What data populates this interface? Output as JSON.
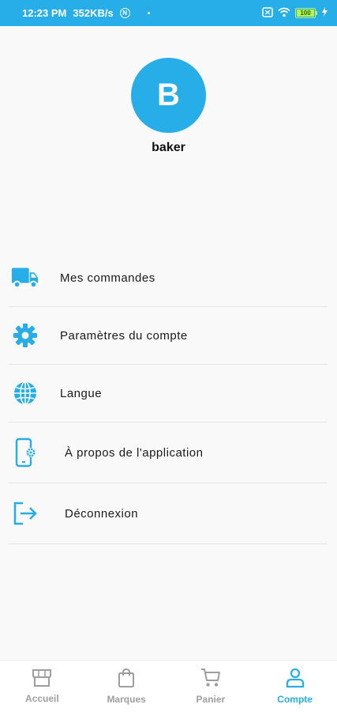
{
  "status_bar": {
    "time": "12:23 PM",
    "speed": "352KB/s",
    "badge": "N",
    "battery": "100"
  },
  "profile": {
    "initial": "B",
    "username": "baker"
  },
  "menu": {
    "items": [
      {
        "label": "Mes commandes",
        "icon": "truck-icon"
      },
      {
        "label": "Paramètres du compte",
        "icon": "gear-icon"
      },
      {
        "label": "Langue",
        "icon": "globe-icon"
      },
      {
        "label": "À propos de l'application",
        "icon": "phone-settings-icon"
      },
      {
        "label": "Déconnexion",
        "icon": "logout-icon"
      }
    ]
  },
  "bottom_nav": {
    "items": [
      {
        "label": "Accueil",
        "icon": "store-icon"
      },
      {
        "label": "Marques",
        "icon": "shopping-bag-icon"
      },
      {
        "label": "Panier",
        "icon": "cart-icon"
      },
      {
        "label": "Compte",
        "icon": "person-icon"
      }
    ],
    "active_index": 3
  },
  "colors": {
    "accent": "#27aee8",
    "inactive": "#9e9e9e",
    "background": "#f9f9f9"
  }
}
